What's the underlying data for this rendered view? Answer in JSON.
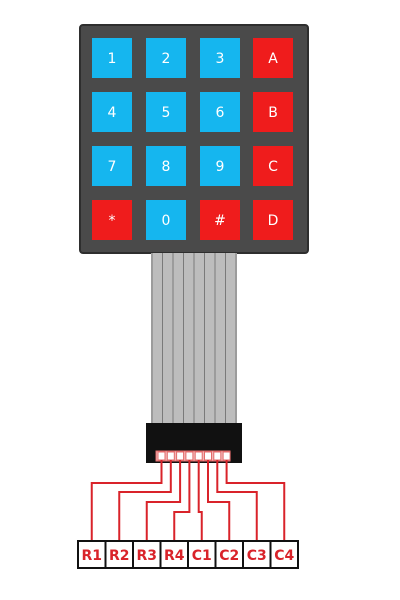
{
  "colors": {
    "keypad_body": "#4a4a4a",
    "key_blue": "#15b6ef",
    "key_red": "#ef1c1c",
    "key_text": "#ffffff",
    "ribbon": "#bdbdbd",
    "ribbon_lines": "#7a7a7a",
    "connector": "#111111",
    "connector_pins": "#e36a6a",
    "wire": "#d9232a",
    "label_text": "#d9232a"
  },
  "keypad": {
    "rows": [
      [
        {
          "label": "1",
          "color": "blue"
        },
        {
          "label": "2",
          "color": "blue"
        },
        {
          "label": "3",
          "color": "blue"
        },
        {
          "label": "A",
          "color": "red"
        }
      ],
      [
        {
          "label": "4",
          "color": "blue"
        },
        {
          "label": "5",
          "color": "blue"
        },
        {
          "label": "6",
          "color": "blue"
        },
        {
          "label": "B",
          "color": "red"
        }
      ],
      [
        {
          "label": "7",
          "color": "blue"
        },
        {
          "label": "8",
          "color": "blue"
        },
        {
          "label": "9",
          "color": "blue"
        },
        {
          "label": "C",
          "color": "red"
        }
      ],
      [
        {
          "label": "*",
          "color": "red"
        },
        {
          "label": "0",
          "color": "blue"
        },
        {
          "label": "#",
          "color": "red"
        },
        {
          "label": "D",
          "color": "red"
        }
      ]
    ]
  },
  "pins": [
    "R1",
    "R2",
    "R3",
    "R4",
    "C1",
    "C2",
    "C3",
    "C4"
  ]
}
